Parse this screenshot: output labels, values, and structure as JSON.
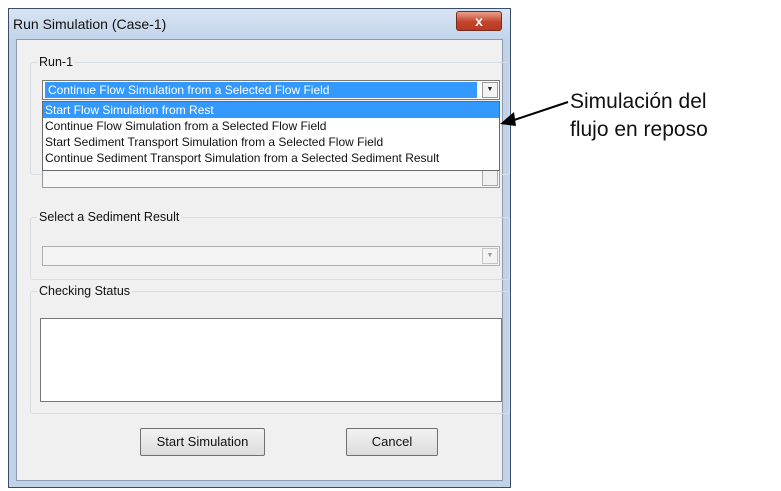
{
  "dialog": {
    "title": "Run Simulation (Case-1)",
    "close_label": "x"
  },
  "run_group": {
    "legend": "Run-1",
    "selected_option": "Continue Flow Simulation from a Selected Flow Field",
    "options": [
      "Start Flow Simulation from Rest",
      "Continue Flow Simulation from a Selected Flow Field",
      "Start Sediment Transport Simulation from a Selected Flow Field",
      "Continue Sediment Transport Simulation from a Selected Sediment Result"
    ],
    "highlighted_option_index": 0
  },
  "sediment_group": {
    "legend": "Select a Sediment Result",
    "selected_option": ""
  },
  "status_group": {
    "legend": "Checking Status",
    "text": ""
  },
  "buttons": {
    "start": "Start Simulation",
    "cancel": "Cancel"
  },
  "annotation": {
    "line1": "Simulación del",
    "line2": "flujo en reposo"
  },
  "colors": {
    "selection": "#3399ff",
    "window_frame": "#c2d3e8",
    "close_button": "#c4432b"
  },
  "icons": {
    "dropdown": "chevron-down-icon",
    "close": "close-icon",
    "arrow": "arrow-left-icon"
  }
}
